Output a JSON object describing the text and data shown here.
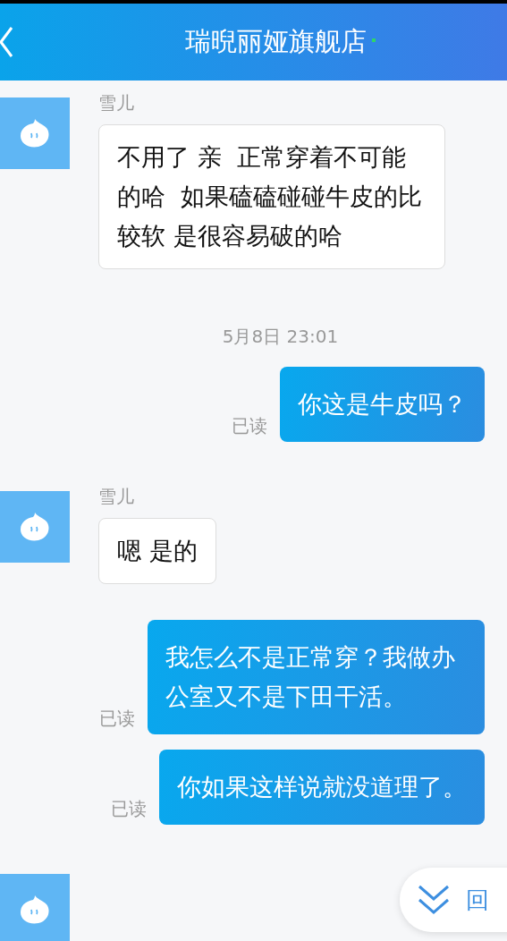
{
  "header": {
    "title": "瑞晲丽娅旗舰店"
  },
  "messages": [
    {
      "kind": "incoming",
      "sender": "雪儿",
      "text": "不用了 亲  正常穿着不可能的哈  如果磕磕碰碰牛皮的比较软 是很容易破的哈"
    },
    {
      "kind": "time",
      "text": "5月8日 23:01"
    },
    {
      "kind": "outgoing",
      "status": "已读",
      "text": "你这是牛皮吗？"
    },
    {
      "kind": "incoming",
      "sender": "雪儿",
      "text": "嗯 是的"
    },
    {
      "kind": "outgoing",
      "status": "已读",
      "text": "我怎么不是正常穿？我做办公室又不是下田干活。"
    },
    {
      "kind": "outgoing",
      "status": "已读",
      "text": "你如果这样说就没道理了。"
    },
    {
      "kind": "avatar_only"
    }
  ],
  "jump_button": {
    "label": "回"
  }
}
